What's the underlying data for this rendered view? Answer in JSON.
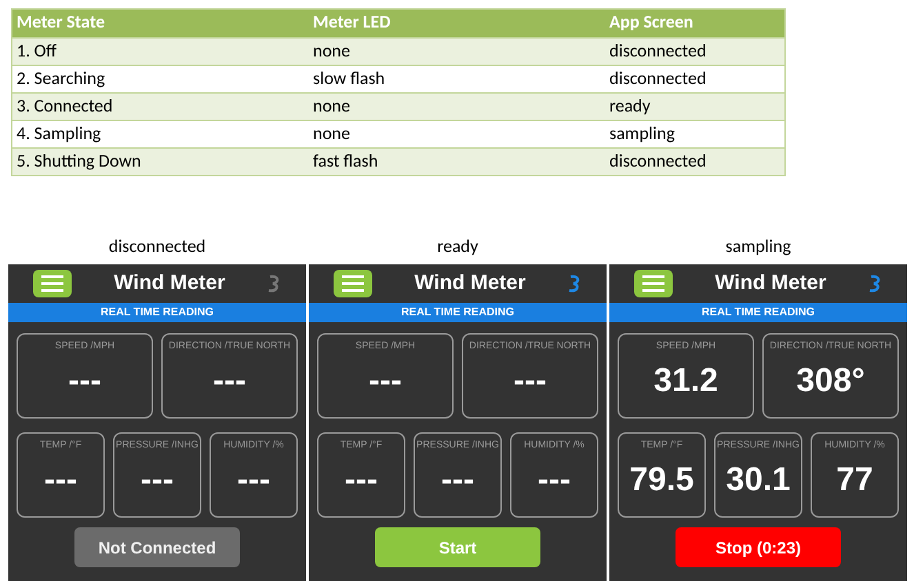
{
  "table": {
    "columns": [
      "Meter State",
      "Meter LED",
      "App Screen"
    ],
    "rows": [
      [
        "1. Off",
        "none",
        "disconnected"
      ],
      [
        "2. Searching",
        "slow flash",
        "disconnected"
      ],
      [
        "3. Connected",
        "none",
        "ready"
      ],
      [
        "4. Sampling",
        "none",
        "sampling"
      ],
      [
        "5. Shutting Down",
        "fast flash",
        "disconnected"
      ]
    ]
  },
  "screens": [
    {
      "caption": "disconnected",
      "title": "Wind Meter",
      "banner": "REAL TIME READING",
      "connected": false,
      "readings": [
        {
          "label": "SPEED /MPH",
          "value": "---"
        },
        {
          "label": "DIRECTION /TRUE NORTH",
          "value": "---"
        },
        {
          "label": "TEMP /°F",
          "value": "---"
        },
        {
          "label": "PRESSURE /INHG",
          "value": "---"
        },
        {
          "label": "HUMIDITY /%",
          "value": "---"
        }
      ],
      "button": {
        "kind": "disabled",
        "label": "Not Connected"
      }
    },
    {
      "caption": "ready",
      "title": "Wind Meter",
      "banner": "REAL TIME READING",
      "connected": true,
      "readings": [
        {
          "label": "SPEED /MPH",
          "value": "---"
        },
        {
          "label": "DIRECTION /TRUE NORTH",
          "value": "---"
        },
        {
          "label": "TEMP /°F",
          "value": "---"
        },
        {
          "label": "PRESSURE /INHG",
          "value": "---"
        },
        {
          "label": "HUMIDITY /%",
          "value": "---"
        }
      ],
      "button": {
        "kind": "start",
        "label": "Start"
      }
    },
    {
      "caption": "sampling",
      "title": "Wind Meter",
      "banner": "REAL TIME READING",
      "connected": true,
      "readings": [
        {
          "label": "SPEED /MPH",
          "value": "31.2"
        },
        {
          "label": "DIRECTION /TRUE NORTH",
          "value": "308°"
        },
        {
          "label": "TEMP /°F",
          "value": "79.5"
        },
        {
          "label": "PRESSURE /INHG",
          "value": "30.1"
        },
        {
          "label": "HUMIDITY /%",
          "value": "77"
        }
      ],
      "button": {
        "kind": "stop",
        "label": "Stop (0:23)"
      }
    }
  ]
}
